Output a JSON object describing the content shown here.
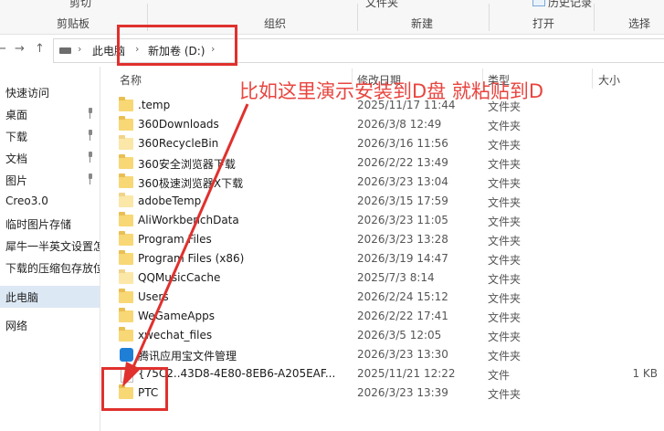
{
  "ribbon": {
    "groups": [
      "剪贴板",
      "组织",
      "新建",
      "打开",
      "选择"
    ],
    "top_items": [
      "剪切",
      "文件夹",
      "历史记录"
    ]
  },
  "address": {
    "back": "←",
    "forward": "→",
    "up": "↑",
    "path": [
      "此电脑",
      "新加卷 (D:)"
    ]
  },
  "sidebar": {
    "items": [
      {
        "label": "快速访问"
      },
      {
        "label": "桌面",
        "pinned": true
      },
      {
        "label": "下载",
        "pinned": true
      },
      {
        "label": "文档",
        "pinned": true
      },
      {
        "label": "图片",
        "pinned": true
      },
      {
        "label": "Creo3.0"
      },
      {
        "label": "临时图片存储"
      },
      {
        "label": "犀牛一半英文设置怎"
      },
      {
        "label": "下载的压缩包存放位"
      },
      {
        "label": "此电脑"
      },
      {
        "label": "网络"
      }
    ]
  },
  "columns": {
    "name": "名称",
    "date": "修改日期",
    "type": "类型",
    "size": "大小"
  },
  "files": [
    {
      "name": ".temp",
      "date": "2025/11/17 11:44",
      "type": "文件夹",
      "size": "",
      "icon": "folder"
    },
    {
      "name": "360Downloads",
      "date": "2026/3/8 12:49",
      "type": "文件夹",
      "size": "",
      "icon": "folder"
    },
    {
      "name": "360RecycleBin",
      "date": "2026/3/16 11:56",
      "type": "文件夹",
      "size": "",
      "icon": "folder-light"
    },
    {
      "name": "360安全浏览器下载",
      "date": "2026/2/22 13:49",
      "type": "文件夹",
      "size": "",
      "icon": "folder"
    },
    {
      "name": "360极速浏览器X下载",
      "date": "2026/3/23 13:04",
      "type": "文件夹",
      "size": "",
      "icon": "folder"
    },
    {
      "name": "adobeTemp",
      "date": "2026/3/15 17:59",
      "type": "文件夹",
      "size": "",
      "icon": "folder-light"
    },
    {
      "name": "AliWorkbenchData",
      "date": "2026/3/23 11:05",
      "type": "文件夹",
      "size": "",
      "icon": "folder"
    },
    {
      "name": "Program Files",
      "date": "2026/3/23 13:28",
      "type": "文件夹",
      "size": "",
      "icon": "folder"
    },
    {
      "name": "Program Files (x86)",
      "date": "2026/3/19 14:47",
      "type": "文件夹",
      "size": "",
      "icon": "folder"
    },
    {
      "name": "QQMusicCache",
      "date": "2025/7/3 8:14",
      "type": "文件夹",
      "size": "",
      "icon": "folder-light"
    },
    {
      "name": "Users",
      "date": "2026/2/24 15:12",
      "type": "文件夹",
      "size": "",
      "icon": "folder"
    },
    {
      "name": "WeGameApps",
      "date": "2026/2/22 17:41",
      "type": "文件夹",
      "size": "",
      "icon": "folder"
    },
    {
      "name": "xwechat_files",
      "date": "2026/3/5 12:05",
      "type": "文件夹",
      "size": "",
      "icon": "folder"
    },
    {
      "name": "腾讯应用宝文件管理",
      "date": "2026/3/23 13:30",
      "type": "文件夹",
      "size": "",
      "icon": "app"
    },
    {
      "name": "{75C2..43D8-4E80-8EB6-A205EAF...",
      "date": "2025/11/21 12:22",
      "type": "文件",
      "size": "1 KB",
      "icon": "file"
    },
    {
      "name": "PTC",
      "date": "2026/3/23 13:39",
      "type": "文件夹",
      "size": "",
      "icon": "folder"
    }
  ],
  "annotation": {
    "text": "比如这里演示安装到D盘 就粘贴到D",
    "color": "#e0312e"
  }
}
